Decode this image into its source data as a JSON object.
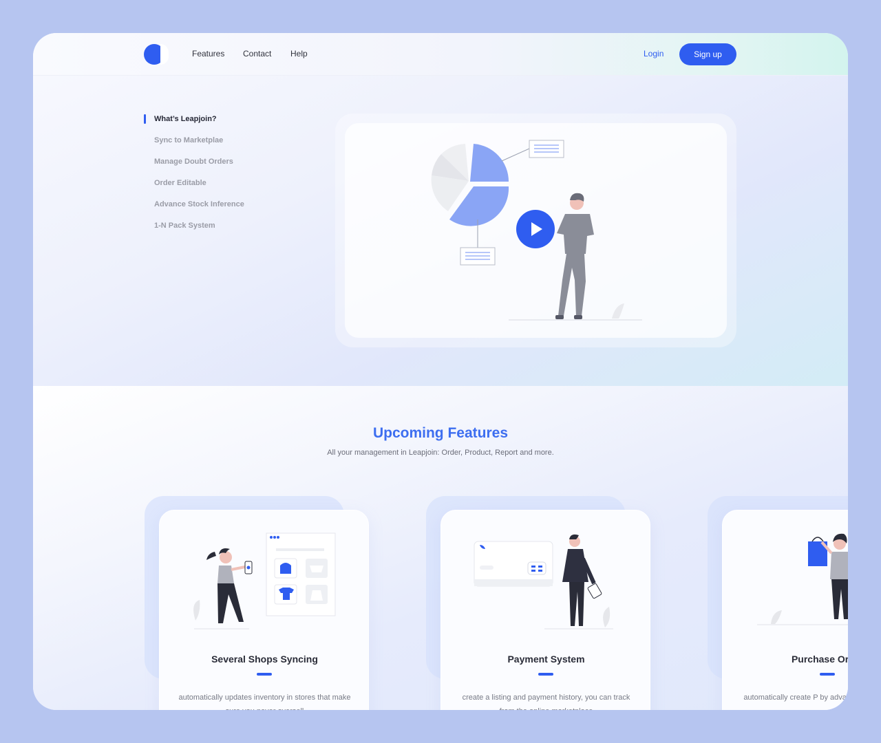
{
  "header": {
    "nav": [
      "Features",
      "Contact",
      "Help"
    ],
    "login_label": "Login",
    "signup_label": "Sign up"
  },
  "hero": {
    "menu": [
      "What’s Leapjoin?",
      "Sync to Marketplae",
      "Manage Doubt Orders",
      "Order Editable",
      "Advance Stock Inference",
      "1-N Pack System"
    ],
    "active_index": 0,
    "video_icon": "play-icon"
  },
  "upcoming": {
    "title": "Upcoming Features",
    "subtitle": "All your management in Leapjoin: Order, Product, Report and more.",
    "cards": [
      {
        "title": "Several Shops Syncing",
        "description": "automatically updates inventory in stores that make sure you never oversell",
        "illustration": "shopping-woman-illustration"
      },
      {
        "title": "Payment System",
        "description": "create a listing and payment history, you can track from the online marketplace",
        "illustration": "payment-man-illustration"
      },
      {
        "title": "Purchase Order",
        "description": "automatically create P by advance stock inference",
        "illustration": "shopping-bag-illustration"
      }
    ]
  },
  "colors": {
    "accent": "#2f5df0",
    "title_blue": "#3d6ef0",
    "page_bg": "#b6c5f0"
  }
}
